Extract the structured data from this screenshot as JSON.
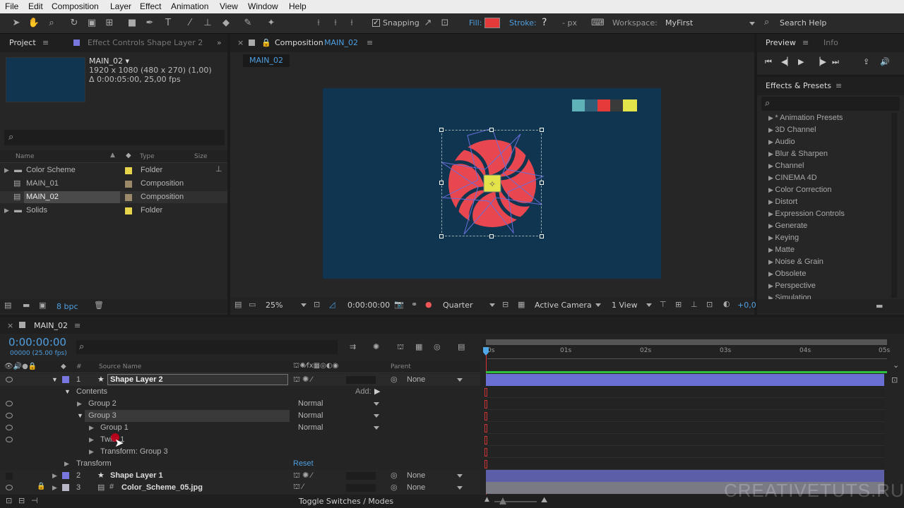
{
  "menu": [
    "File",
    "Edit",
    "Composition",
    "Layer",
    "Effect",
    "Animation",
    "View",
    "Window",
    "Help"
  ],
  "toolbar": {
    "snapping": "Snapping",
    "fill": "Fill:",
    "stroke": "Stroke:",
    "stroke_q": "?",
    "px": "- px",
    "workspace_label": "Workspace:",
    "workspace": "MyFirst",
    "search": "Search Help",
    "fill_color": "#e53a3a"
  },
  "project": {
    "tab": "Project",
    "tab2": "Effect Controls Shape Layer 2",
    "comp_name": "MAIN_02 ▾",
    "comp_info1": "1920 x 1080  (480 x 270) (1,00)",
    "comp_info2": "Δ 0:00:05:00, 25,00 fps",
    "col_name": "Name",
    "col_type": "Type",
    "col_size": "Size",
    "items": [
      {
        "name": "Color Scheme",
        "type": "Folder",
        "color": "#e8d44a"
      },
      {
        "name": "MAIN_01",
        "type": "Composition",
        "color": "#9a8a6a"
      },
      {
        "name": "MAIN_02",
        "type": "Composition",
        "color": "#9a8a6a"
      },
      {
        "name": "Solids",
        "type": "Folder",
        "color": "#e8d44a"
      }
    ],
    "bpc": "8 bpc"
  },
  "composition": {
    "tab_prefix": "Composition",
    "tab_name": "MAIN_02",
    "subtab": "MAIN_02",
    "zoom": "25%",
    "time": "0:00:00:00",
    "quality": "Quarter",
    "camera": "Active Camera",
    "views": "1 View",
    "offset": "+0,0",
    "palette": [
      "#5fb3b8",
      "#2e5e78",
      "#e53a3a",
      "#3a3a3a",
      "#e3e34a"
    ]
  },
  "preview": {
    "tab": "Preview",
    "tab2": "Info"
  },
  "effects": {
    "tab": "Effects & Presets",
    "items": [
      "* Animation Presets",
      "3D Channel",
      "Audio",
      "Blur & Sharpen",
      "Channel",
      "CINEMA 4D",
      "Color Correction",
      "Distort",
      "Expression Controls",
      "Generate",
      "Keying",
      "Matte",
      "Noise & Grain",
      "Obsolete",
      "Perspective",
      "Simulation"
    ]
  },
  "timeline": {
    "tab": "MAIN_02",
    "timecode": "0:00:00:00",
    "frames": "00000 (25.00 fps)",
    "col_source": "Source Name",
    "col_parent": "Parent",
    "ticks": [
      "0s",
      "01s",
      "02s",
      "03s",
      "04s",
      "05s"
    ],
    "add": "Add:",
    "rows": [
      {
        "num": "1",
        "name": "Shape Layer 2",
        "parent": "None"
      },
      {
        "label": "Contents"
      },
      {
        "label": "Group 2",
        "mode": "Normal"
      },
      {
        "label": "Group 3",
        "mode": "Normal"
      },
      {
        "label": "Group 1",
        "mode": "Normal"
      },
      {
        "label": "Twist 1"
      },
      {
        "label": "Transform: Group 3"
      },
      {
        "label": "Transform",
        "reset": "Reset"
      },
      {
        "num": "2",
        "name": "Shape Layer 1",
        "parent": "None"
      },
      {
        "num": "3",
        "name": "Color_Scheme_05.jpg",
        "parent": "None"
      }
    ],
    "toggle": "Toggle Switches / Modes"
  },
  "watermark": "CREATIVETUTS.RU"
}
